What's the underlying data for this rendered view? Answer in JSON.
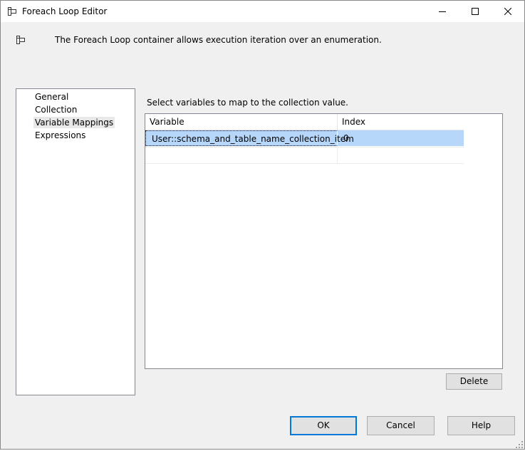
{
  "window": {
    "title": "Foreach Loop Editor"
  },
  "header": {
    "description": "The Foreach Loop container allows execution iteration over an enumeration."
  },
  "nav": {
    "items": [
      {
        "label": "General"
      },
      {
        "label": "Collection"
      },
      {
        "label": "Variable Mappings",
        "selected": true
      },
      {
        "label": "Expressions"
      }
    ]
  },
  "mappings": {
    "instruction": "Select variables to map to the collection value.",
    "columns": [
      "Variable",
      "Index"
    ],
    "rows": [
      {
        "variable": "User::schema_and_table_name_collection_item",
        "index": "0"
      }
    ],
    "delete_label": "Delete"
  },
  "footer": {
    "ok_label": "OK",
    "cancel_label": "Cancel",
    "help_label": "Help"
  },
  "colors": {
    "selection": "#b7d7fa",
    "default_button_border": "#0078d7"
  }
}
